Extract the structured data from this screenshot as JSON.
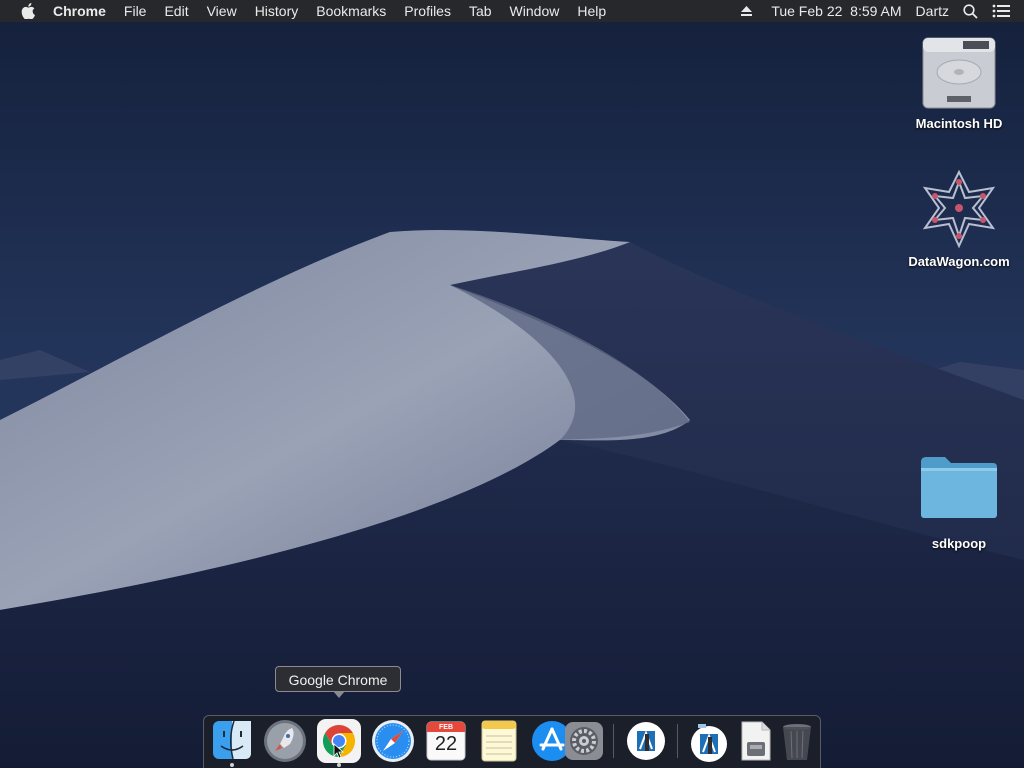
{
  "menubar": {
    "apple_icon": "apple-icon",
    "app_name": "Chrome",
    "menus": [
      "File",
      "Edit",
      "View",
      "History",
      "Bookmarks",
      "Profiles",
      "Tab",
      "Window",
      "Help"
    ],
    "eject_icon": "eject-icon",
    "clock": "Tue Feb 22  8:59 AM",
    "user": "Dartz",
    "search_icon": "spotlight-search-icon",
    "list_icon": "notification-center-icon"
  },
  "desktop": {
    "icons": [
      {
        "label": "Macintosh HD",
        "icon": "hard-drive-icon"
      },
      {
        "label": "DataWagon.com",
        "icon": "network-volume-icon"
      },
      {
        "label": "sdkpoop",
        "icon": "folder-icon"
      }
    ]
  },
  "tooltip": {
    "text": "Google Chrome"
  },
  "dock": {
    "items": [
      {
        "name": "Finder",
        "icon": "finder-icon",
        "running": true
      },
      {
        "name": "Launchpad",
        "icon": "launchpad-icon",
        "running": false
      },
      {
        "name": "Google Chrome",
        "icon": "chrome-icon",
        "running": true
      },
      {
        "name": "Safari",
        "icon": "safari-icon",
        "running": false
      },
      {
        "name": "Calendar",
        "icon": "calendar-icon",
        "running": false,
        "month": "FEB",
        "day": "22"
      },
      {
        "name": "Notes",
        "icon": "notes-icon",
        "running": false
      },
      {
        "name": "App Store",
        "icon": "app-store-icon",
        "running": false
      },
      {
        "name": "System Preferences",
        "icon": "system-preferences-icon",
        "running": false
      },
      {
        "name": "Xcode Instruments",
        "icon": "instruments-icon",
        "running": false
      },
      {
        "name": "Downloads stack",
        "icon": "downloads-stack-icon",
        "running": false
      },
      {
        "name": "Document stack",
        "icon": "document-stack-icon",
        "running": false
      },
      {
        "name": "Trash",
        "icon": "trash-icon",
        "running": false
      }
    ]
  },
  "colors": {
    "menubar_bg": "#26282c",
    "sky_top": "#16213d",
    "sky_bottom": "#2e3e63",
    "dune": "#8e96aa"
  }
}
